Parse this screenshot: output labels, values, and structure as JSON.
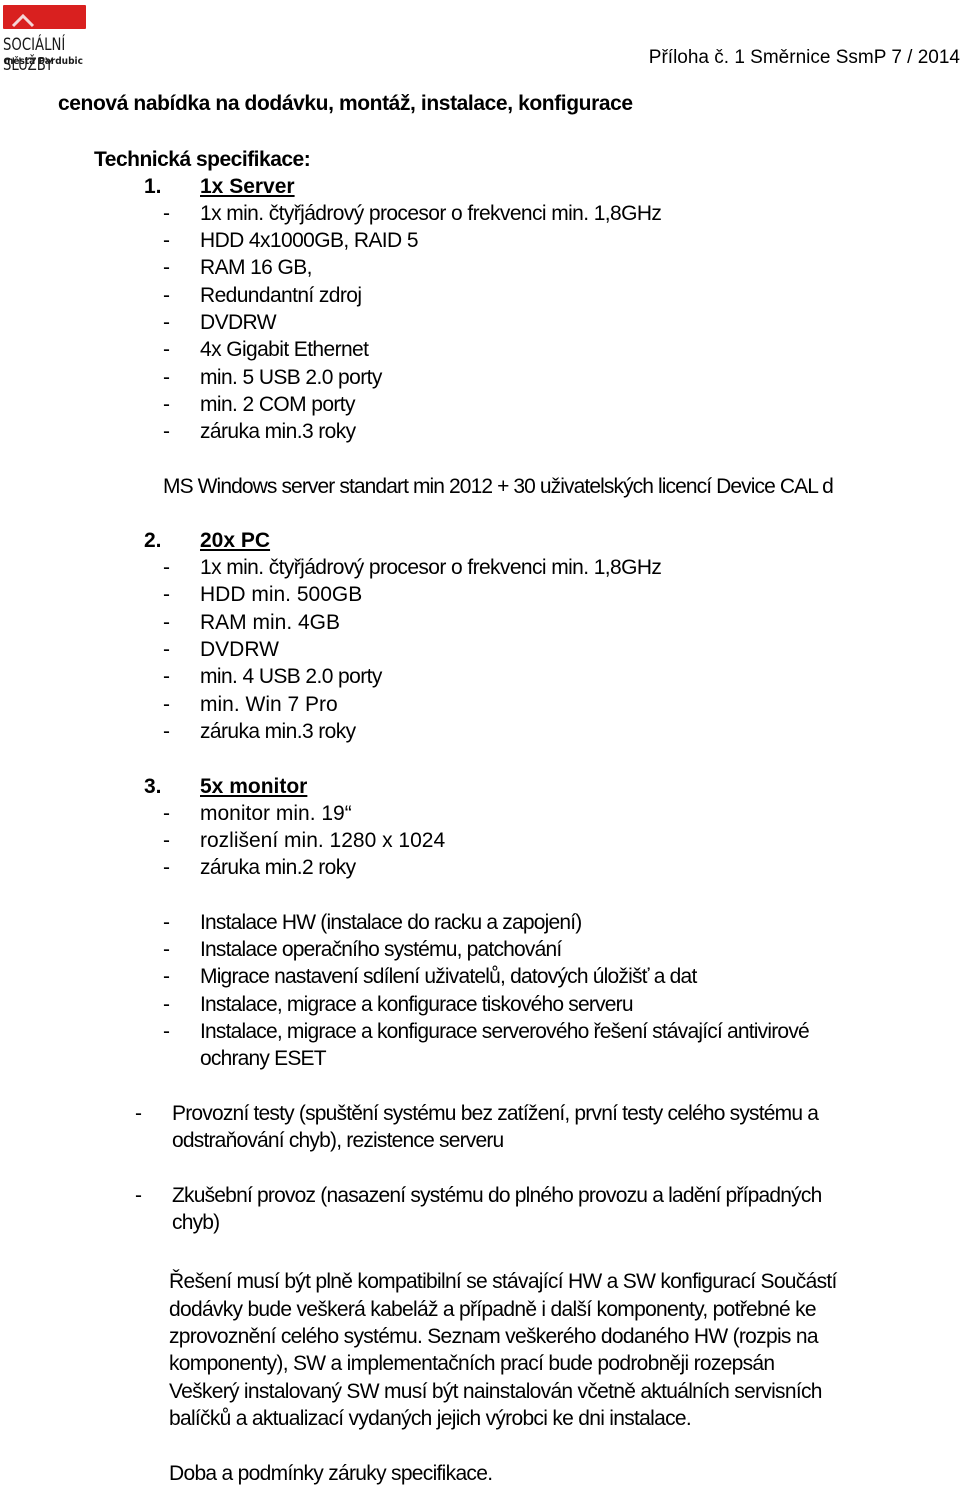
{
  "header": {
    "logo": {
      "icon": "chevron-up-icon",
      "brand_color": "#d9201f",
      "name": "SOCIÁLNÍ SLUŽBY",
      "subtitle": "města Pardubic"
    },
    "annex_label": "Příloha č. 1 Směrnice SsmP  7 / 2014"
  },
  "document": {
    "title": "cenová nabídka na dodávku, montáž, instalace, konfigurace",
    "spec_heading": "Technická specifikace:",
    "sections": [
      {
        "number": "1.",
        "title": "1x Server",
        "items": [
          "1x min. čtyřjádrový procesor o frekvenci min. 1,8GHz",
          "HDD 4x1000GB, RAID 5",
          "RAM 16 GB,",
          "Redundantní zdroj",
          "DVDRW",
          "4x Gigabit Ethernet",
          "min. 5 USB 2.0 porty",
          "min. 2 COM porty",
          "záruka min.3 roky"
        ],
        "note": "MS Windows server standart min 2012 + 30 uživatelských licencí Device CAL d"
      },
      {
        "number": "2.",
        "title": "20x PC",
        "items": [
          "1x min. čtyřjádrový procesor o frekvenci min. 1,8GHz",
          "HDD min. 500GB",
          "RAM min. 4GB",
          "DVDRW",
          "min. 4 USB 2.0 porty",
          "min. Win 7 Pro",
          "záruka min.3 roky"
        ]
      },
      {
        "number": "3.",
        "title": "5x monitor",
        "items": [
          "monitor min. 19“",
          "rozlišení min. 1280 x 1024",
          "záruka min.2 roky"
        ]
      }
    ],
    "services": [
      "Instalace HW (instalace do racku a zapojení)",
      "Instalace operačního systému, patchování",
      "Migrace nastavení sdílení uživatelů, datových úložišť a dat",
      "Instalace, migrace a konfigurace tiskového serveru",
      "Instalace, migrace a konfigurace serverového řešení stávající antivirové",
      "ochrany ESET"
    ],
    "tests": [
      {
        "line1": "Provozní testy (spuštění systému bez zatížení, první testy celého systému a",
        "line2": "odstraňování chyb), rezistence serveru"
      },
      {
        "line1": "Zkušební provoz (nasazení systému do plného provozu a ladění případných",
        "line2": "chyb)"
      }
    ],
    "paragraph_lines": [
      "Řešení musí být plně kompatibilní se stávající HW a SW konfigurací Součástí",
      "dodávky bude veškerá kabeláž a případně i další komponenty, potřebné ke",
      "zprovoznění celého systému. Seznam veškerého dodaného HW (rozpis na",
      "komponenty), SW a implementačních prací bude podrobněji rozepsán",
      "Veškerý instalovaný SW musí být nainstalován včetně aktuálních servisních",
      "balíčků a aktualizací vydaných jejich výrobci ke dni instalace."
    ],
    "closing": "Doba a podmínky záruky specifikace.",
    "dash": "-"
  }
}
